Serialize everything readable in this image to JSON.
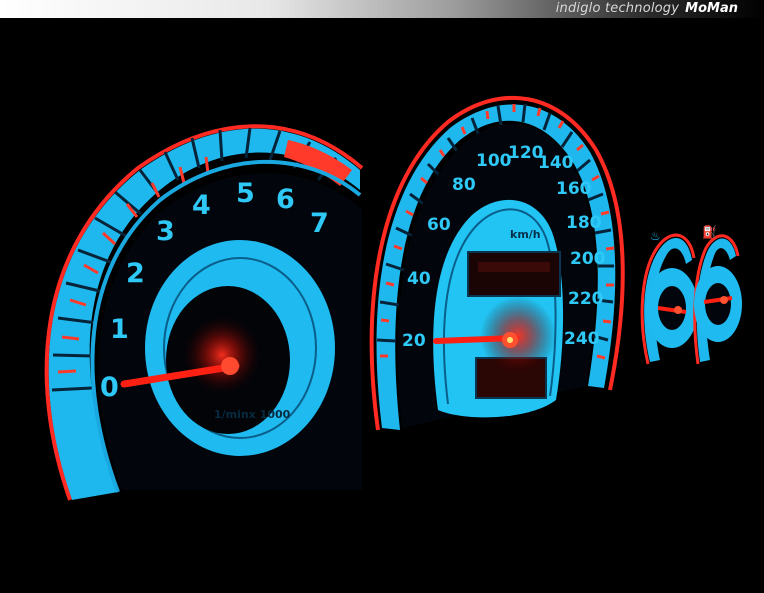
{
  "banner": {
    "tech_text": "indiglo technology",
    "brand_text": "MoMan"
  },
  "tachometer": {
    "scale_labels": [
      "0",
      "1",
      "2",
      "3",
      "4",
      "5",
      "6",
      "7"
    ],
    "unit_label": "1/minx 1000"
  },
  "speedometer": {
    "scale_labels": [
      "20",
      "40",
      "60",
      "80",
      "100",
      "120",
      "140",
      "160",
      "180",
      "200",
      "220",
      "240"
    ],
    "unit_label": "km/h"
  },
  "colors": {
    "glow_blue": "#22c8f5",
    "redline": "#ff2a22",
    "needle": "#ff1a10",
    "background": "#000000"
  }
}
